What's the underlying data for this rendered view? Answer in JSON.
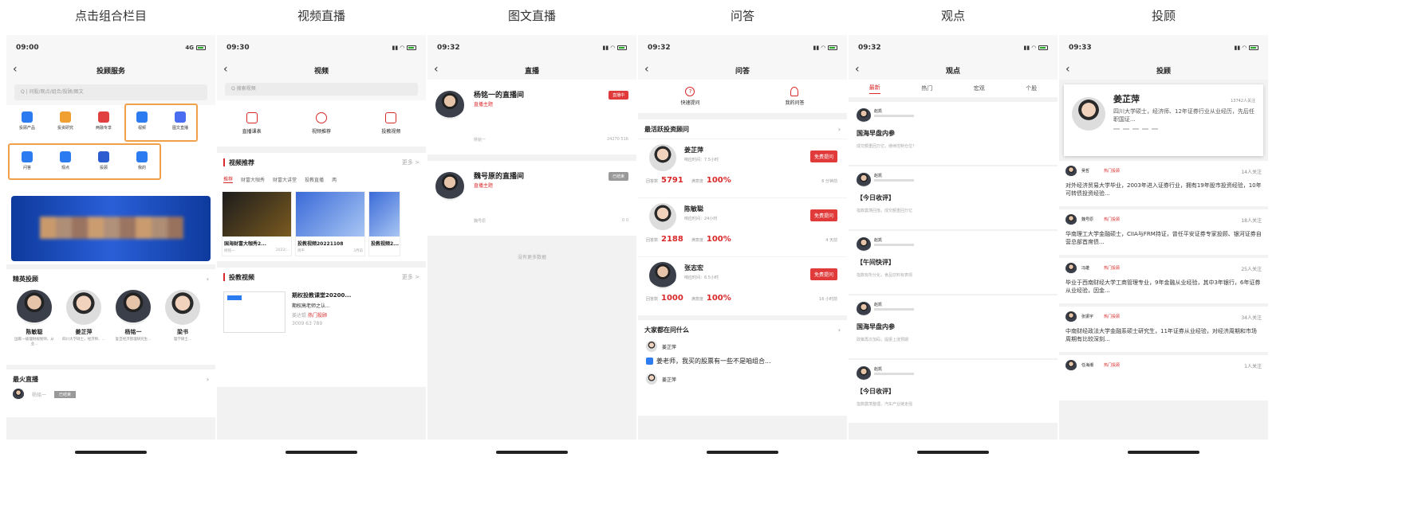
{
  "titles": [
    "点击组合栏目",
    "视频直播",
    "图文直播",
    "问答",
    "观点",
    "投顾"
  ],
  "p1": {
    "time": "09:00",
    "net": "4G",
    "nav": "投顾服务",
    "search": "Q | 问股/观点/组合/投顾/图文",
    "icons": [
      {
        "label": "投顾产品",
        "color": "#2d7bf0"
      },
      {
        "label": "投资研究",
        "color": "#f0a030"
      },
      {
        "label": "两融专享",
        "color": "#e04040"
      },
      {
        "label": "视频",
        "color": "#2d7bf0"
      },
      {
        "label": "图文直播",
        "color": "#4a6cf0"
      },
      {
        "label": "问答",
        "color": "#2d7bf0"
      },
      {
        "label": "观点",
        "color": "#2d7bf0"
      },
      {
        "label": "投顾",
        "color": "#2d5bd0"
      },
      {
        "label": "我的",
        "color": "#2d7bf0"
      }
    ],
    "sec1": "精英投顾",
    "people": [
      {
        "name": "陈敏聪",
        "desc": "国家一级理财规划师、从业..."
      },
      {
        "name": "姜芷萍",
        "desc": "四川大学硕士，经济师、..."
      },
      {
        "name": "杨铭一",
        "desc": "复旦经济管理研究生..."
      },
      {
        "name": "梁书",
        "desc": "理学硕士..."
      }
    ],
    "sec2": "最火直播",
    "live": "杨铭一",
    "livetag": "已结束"
  },
  "p2": {
    "time": "09:30",
    "nav": "视频",
    "search": "Q 搜索视频",
    "icons": [
      "直播课表",
      "视频推荐",
      "投教视频"
    ],
    "sec1": "视频推荐",
    "more": "更多 >",
    "tabs": [
      "推荐",
      "财富大咖秀",
      "财富大讲堂",
      "投教直播",
      "两"
    ],
    "cards": [
      {
        "t": "国海财富大咖秀2...",
        "a": "杨铭一",
        "d": "2022/..."
      },
      {
        "t": "投教视频20221108",
        "a": "周平",
        "d": "3月前"
      },
      {
        "t": "投教视频2...",
        "a": "",
        "d": ""
      }
    ],
    "sec2": "投教视频",
    "vid": {
      "t": "期权投教课堂20200...",
      "s": "期权高老师之认...",
      "a": "姜达锟",
      "tag": "热门投顾",
      "stats": "3009  63  789"
    }
  },
  "p3": {
    "time": "09:32",
    "nav": "直播",
    "rooms": [
      {
        "name": "杨铭一的直播间",
        "sub": "直播主题",
        "tag": "直播中",
        "host": "杨铭一",
        "stats": "24270  516"
      },
      {
        "name": "魏号原的直播间",
        "sub": "直播主题",
        "tag": "已结束",
        "host": "魏号原",
        "stats": "0  0"
      }
    ],
    "nomore": "没有更多数据"
  },
  "p4": {
    "time": "09:32",
    "nav": "问答",
    "tabs": [
      "快速提问",
      "我的问答"
    ],
    "sec1": "最活跃投资顾问",
    "advisors": [
      {
        "name": "姜芷萍",
        "resp": "响应时间：7.5小时",
        "ans": "5791",
        "rate": "100%",
        "time": "6 分钟前"
      },
      {
        "name": "陈敏聪",
        "resp": "响应时间：24小时",
        "ans": "2188",
        "rate": "100%",
        "time": "4 天前"
      },
      {
        "name": "张志宏",
        "resp": "响应时间：6.5小时",
        "ans": "1000",
        "rate": "100%",
        "time": "16 小时前"
      }
    ],
    "btn": "免费提问",
    "anslabel": "回答数",
    "ratelabel": "满意度",
    "sec2": "大家都在问什么",
    "q": {
      "name": "姜芷萍",
      "text": "姜老师，我买的股票有一些不是咱组合..."
    },
    "last": "姜芷萍"
  },
  "p5": {
    "time": "09:32",
    "nav": "观点",
    "tabs": [
      "最新",
      "热门",
      "宏观",
      "个股"
    ],
    "posts": [
      {
        "a": "赵凯",
        "t": "国海早盘内参",
        "s": "成交额重回万亿，继续控制仓位？"
      },
      {
        "a": "赵凯",
        "t": "【今日收评】",
        "s": "指数震荡回落，成交额重回万亿"
      },
      {
        "a": "赵凯",
        "t": "【午间快评】",
        "s": "指数有所分化，食品饮料有表现"
      },
      {
        "a": "赵凯",
        "t": "国海早盘内参",
        "s": "政策再次加码，提振上涨预期"
      },
      {
        "a": "赵凯",
        "t": "【今日收评】",
        "s": "指数震荡整理，汽车产业链走强"
      }
    ]
  },
  "p6": {
    "time": "09:33",
    "nav": "投顾",
    "top": {
      "name": "姜芷萍",
      "followers": "13742人关注",
      "desc": "四川大学硕士，经济师、12年证券行业从业经历，先后任职国证..."
    },
    "list": [
      {
        "n": "吴哲",
        "tag": "热门投顾",
        "f": "14人关注",
        "d": "对外经济贸易大学毕业，2003年进入证券行业，拥有19年股市投资经验，10年可转债投资经验..."
      },
      {
        "n": "魏号原",
        "tag": "热门投顾",
        "f": "18人关注",
        "d": "华南理工大学金融硕士，CIIA与FRM持证，曾任平安证券专家投顾、银河证券自营总部首席债..."
      },
      {
        "n": "冯雄",
        "tag": "热门投顾",
        "f": "25人关注",
        "d": "毕业于西南财经大学工商管理专业，9年金融从业经验，其中3年银行，6年证券从业经验，因金..."
      },
      {
        "n": "张振宇",
        "tag": "热门投顾",
        "f": "34人关注",
        "d": "中南财经政法大学金融系硕士研究生，11年证券从业经验，对经济周期和市场周期有比较深刻..."
      },
      {
        "n": "任海潮",
        "tag": "热门投顾",
        "f": "1人关注",
        "d": ""
      }
    ]
  }
}
